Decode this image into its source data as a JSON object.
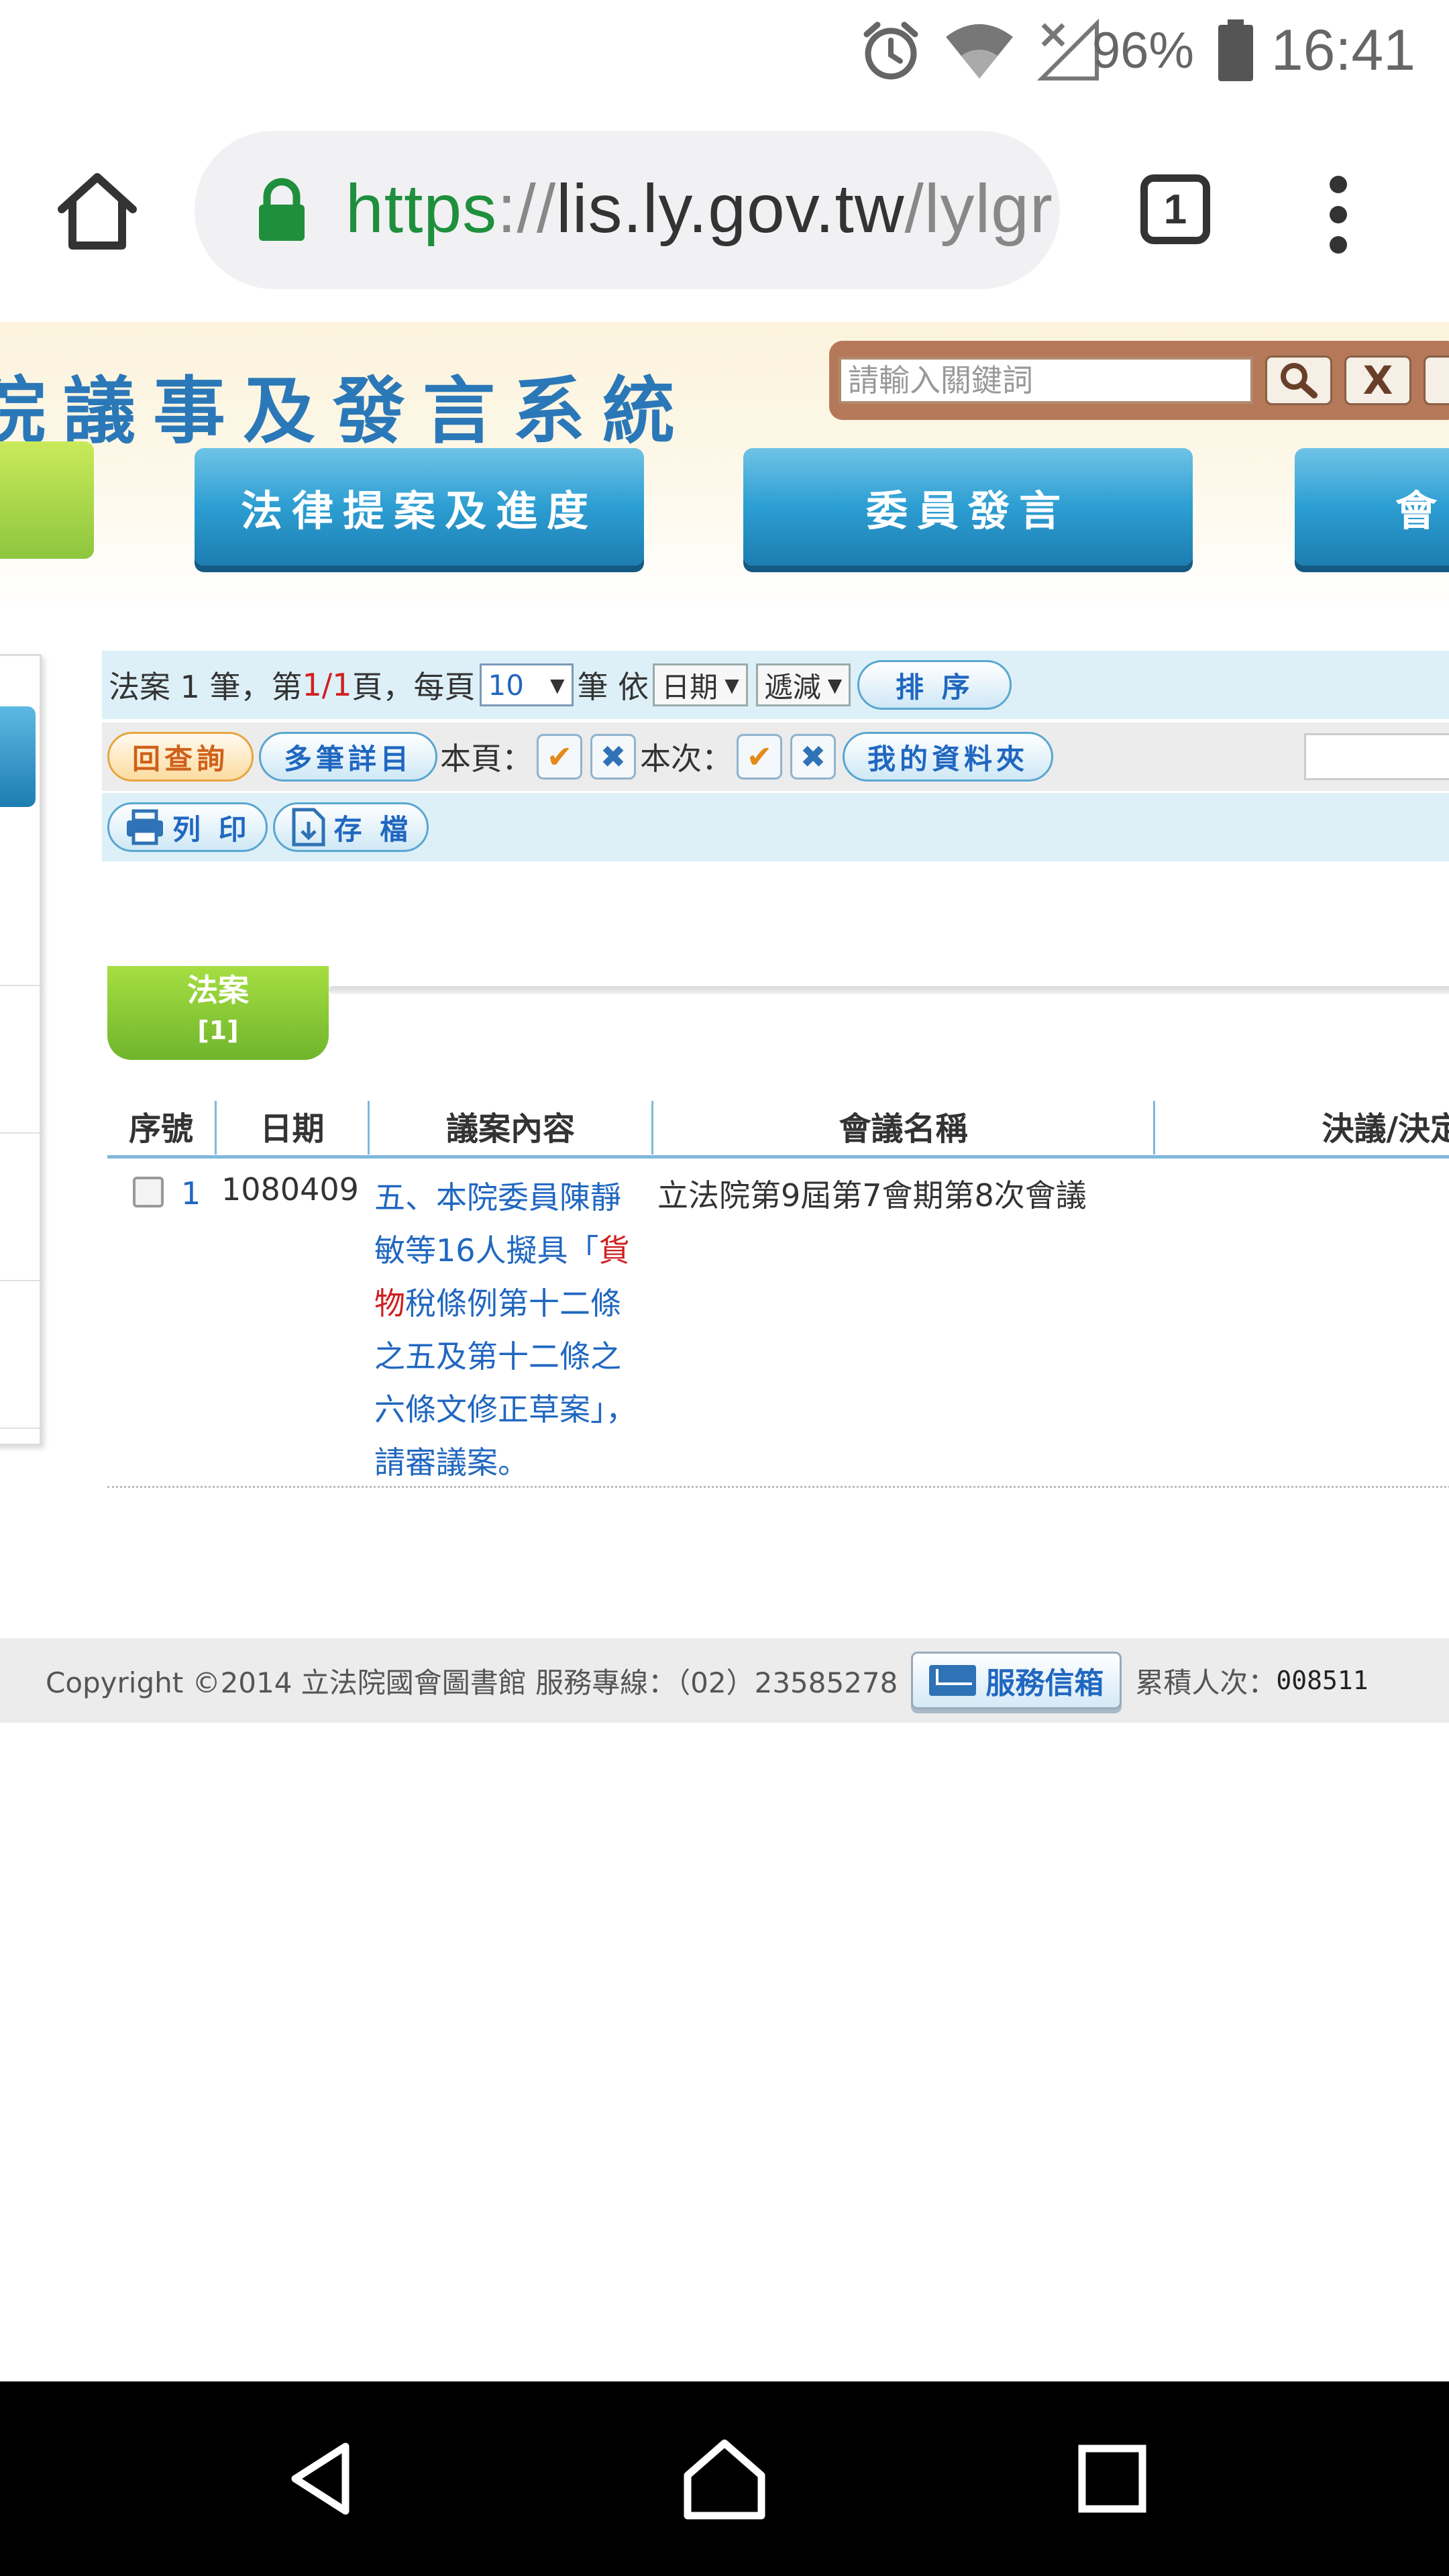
{
  "status_bar": {
    "battery_percent": "96%",
    "time": "16:41",
    "icons": [
      "alarm-icon",
      "wifi-icon",
      "no-signal-icon",
      "battery-icon"
    ]
  },
  "browser": {
    "url": {
      "scheme": "https",
      "separator": "://",
      "host": "lis.ly.gov.tw",
      "path": "/lylgr"
    },
    "tab_count": "1",
    "icons": [
      "home-icon",
      "lock-icon",
      "tab-switcher-icon",
      "overflow-menu-icon"
    ]
  },
  "header": {
    "site_title": "院議事及發言系統",
    "search_placeholder": "請輸入關鍵詞",
    "search_button_icon": "magnifier-icon",
    "clear_button_label": "X",
    "nav": [
      {
        "label": "法律提案及進度"
      },
      {
        "label": "委員發言"
      },
      {
        "label": "會"
      }
    ]
  },
  "result_bar": {
    "prefix": "法案 1 筆，第",
    "current_page": "1/1",
    "per_page_prefix": "頁，每頁",
    "per_page_value": "10",
    "sort_by_prefix": "筆 依",
    "sort_field": "日期",
    "sort_order": "遞減",
    "sort_button": "排 序"
  },
  "action_bar": {
    "back_button": "回查詢",
    "multi_detail_button": "多筆詳目",
    "this_page_label": "本頁：",
    "this_time_label": "本次：",
    "my_folder_button": "我的資料夾"
  },
  "output_bar": {
    "print_button": "列 印",
    "save_button": "存 檔"
  },
  "tab": {
    "label": "法案",
    "count": "[1]"
  },
  "table": {
    "columns": [
      "序號",
      "日期",
      "議案內容",
      "會議名稱",
      "決議/決定"
    ],
    "rows": [
      {
        "seq": "1",
        "date": "1080409",
        "content_before": "五、本院委員陳靜敏等16人擬具「",
        "content_highlight": "貨物",
        "content_after": "稅條例第十二條之五及第十二條之六條文修正草案」，請審議案。",
        "meeting": "立法院第9屆第7會期第8次會議"
      }
    ]
  },
  "footer": {
    "copyright": "Copyright ©2014 立法院國會圖書館 服務專線：（02）23585278",
    "mail_button": "服務信箱",
    "visits_label": "累積人次：",
    "visits_count": "008511"
  },
  "colors": {
    "link_blue": "#2067c0",
    "highlight_red": "#d02020",
    "https_green": "#1f8f3d",
    "ribbon_blue": "#2c9ed2",
    "tab_green": "#8ec63f"
  }
}
